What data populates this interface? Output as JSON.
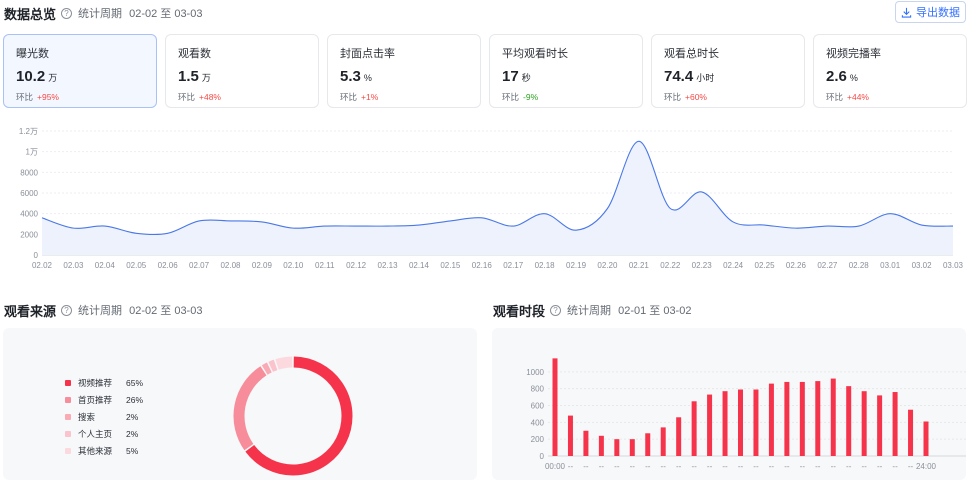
{
  "overview": {
    "title": "数据总览",
    "period_label": "统计周期",
    "period_range": "02-02 至 03-03",
    "export_label": "导出数据"
  },
  "metrics": [
    {
      "label": "曝光数",
      "value": "10.2",
      "unit": "万",
      "change_label": "环比",
      "change": "+95%",
      "trend": "up",
      "active": true
    },
    {
      "label": "观看数",
      "value": "1.5",
      "unit": "万",
      "change_label": "环比",
      "change": "+48%",
      "trend": "up",
      "active": false
    },
    {
      "label": "封面点击率",
      "value": "5.3",
      "unit": "%",
      "change_label": "环比",
      "change": "+1%",
      "trend": "up",
      "active": false
    },
    {
      "label": "平均观看时长",
      "value": "17",
      "unit": "秒",
      "change_label": "环比",
      "change": "-9%",
      "trend": "down",
      "active": false
    },
    {
      "label": "观看总时长",
      "value": "74.4",
      "unit": "小时",
      "change_label": "环比",
      "change": "+60%",
      "trend": "up",
      "active": false
    },
    {
      "label": "视频完播率",
      "value": "2.6",
      "unit": "%",
      "change_label": "环比",
      "change": "+44%",
      "trend": "up",
      "active": false
    }
  ],
  "chart_data": [
    {
      "type": "area",
      "title": "",
      "categories": [
        "02.02",
        "02.03",
        "02.04",
        "02.05",
        "02.06",
        "02.07",
        "02.08",
        "02.09",
        "02.10",
        "02.11",
        "02.12",
        "02.13",
        "02.14",
        "02.15",
        "02.16",
        "02.17",
        "02.18",
        "02.19",
        "02.20",
        "02.21",
        "02.22",
        "02.23",
        "02.24",
        "02.25",
        "02.26",
        "02.27",
        "02.28",
        "03.01",
        "03.02",
        "03.03"
      ],
      "values": [
        3600,
        2600,
        2800,
        2100,
        2100,
        3300,
        3300,
        3200,
        2600,
        2800,
        2800,
        2800,
        2900,
        3300,
        3600,
        2800,
        4000,
        2400,
        4500,
        11000,
        4500,
        6100,
        3200,
        2900,
        2600,
        2800,
        2800,
        4000,
        2900,
        2800
      ],
      "yticks": [
        "0",
        "2000",
        "4000",
        "6000",
        "8000",
        "1万",
        "1.2万"
      ],
      "ylim": [
        0,
        12000
      ],
      "color": "#4a78e8",
      "grid": true
    },
    {
      "type": "pie",
      "title": "观看来源",
      "period_label": "统计周期",
      "period_range": "02-02 至 03-03",
      "slices": [
        {
          "name": "视频推荐",
          "value": 65,
          "label": "65%",
          "color": "#f5344b"
        },
        {
          "name": "首页推荐",
          "value": 26,
          "label": "26%",
          "color": "#f78d9b"
        },
        {
          "name": "搜索",
          "value": 2,
          "label": "2%",
          "color": "#f9aab4"
        },
        {
          "name": "个人主页",
          "value": 2,
          "label": "2%",
          "color": "#fbc3cb"
        },
        {
          "name": "其他来源",
          "value": 5,
          "label": "5%",
          "color": "#fcd9de"
        }
      ]
    },
    {
      "type": "bar",
      "title": "观看时段",
      "period_label": "统计周期",
      "period_range": "02-01 至 03-02",
      "values": [
        1160,
        480,
        300,
        240,
        200,
        200,
        270,
        340,
        460,
        650,
        730,
        770,
        790,
        790,
        860,
        880,
        880,
        890,
        920,
        830,
        770,
        720,
        760,
        550,
        410
      ],
      "xticks": [
        "00:00",
        "--",
        "--",
        "--",
        "--",
        "--",
        "--",
        "--",
        "--",
        "--",
        "--",
        "--",
        "--",
        "--",
        "--",
        "--",
        "--",
        "--",
        "--",
        "--",
        "--",
        "--",
        "--",
        "--",
        "24:00"
      ],
      "yticks": [
        "0",
        "200",
        "400",
        "600",
        "800",
        "1000"
      ],
      "ylim": [
        0,
        1200
      ],
      "color": "#f5344b",
      "grid": true
    }
  ]
}
